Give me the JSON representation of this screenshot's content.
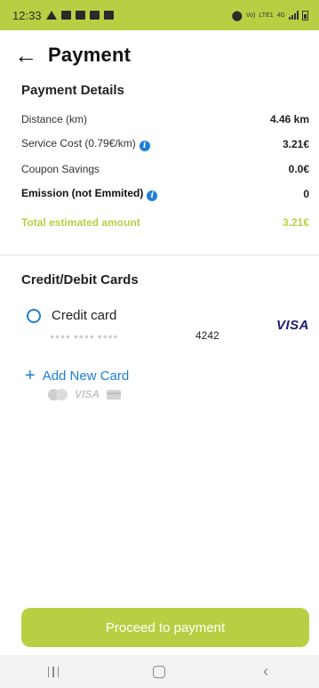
{
  "status_bar": {
    "time": "12:33",
    "network_top": "Vo)",
    "network_mid": "4G",
    "network_bottom": "LTE1"
  },
  "header": {
    "back_icon": "arrow-left-icon",
    "title": "Payment"
  },
  "payment_details": {
    "title": "Payment Details",
    "rows": [
      {
        "label": "Distance (km)",
        "value": "4.46 km"
      },
      {
        "label": "Service Cost (0.79€/km)",
        "value": "3.21€",
        "info": true
      },
      {
        "label": "Coupon Savings",
        "value": "0.0€"
      },
      {
        "label": "Emission (not Emmited)",
        "value": "0",
        "info": true
      }
    ],
    "total": {
      "label": "Total estimated amount",
      "value": "3.21€"
    }
  },
  "cards": {
    "title": "Credit/Debit Cards",
    "items": [
      {
        "name": "Credit card",
        "masked": "●●●● ●●●● ●●●●",
        "last4": "4242",
        "brand": "VISA"
      }
    ],
    "add_label": "Add New Card",
    "brands_gray": "VISA"
  },
  "actions": {
    "proceed": "Proceed to payment"
  },
  "colors": {
    "brand_green": "#b9cf43",
    "link_blue": "#1e7fd6",
    "visa_navy": "#1a1f71"
  }
}
